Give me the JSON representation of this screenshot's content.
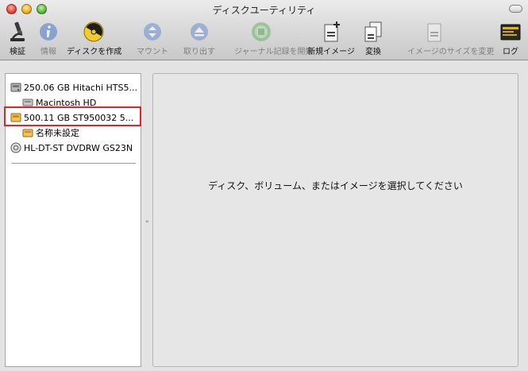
{
  "window": {
    "title": "ディスクユーティリティ"
  },
  "toolbar": {
    "items": [
      {
        "label": "検証",
        "icon": "microscope-icon",
        "enabled": true
      },
      {
        "label": "情報",
        "icon": "info-icon",
        "enabled": false
      },
      {
        "label": "ディスクを作成",
        "icon": "burn-icon",
        "enabled": true
      },
      {
        "label": "マウント",
        "icon": "mount-icon",
        "enabled": false
      },
      {
        "label": "取り出す",
        "icon": "eject-icon",
        "enabled": false
      },
      {
        "label": "ジャーナル記録を開始",
        "icon": "journal-icon",
        "enabled": false
      },
      {
        "label": "新規イメージ",
        "icon": "new-image-icon",
        "enabled": true
      },
      {
        "label": "変換",
        "icon": "convert-icon",
        "enabled": true
      },
      {
        "label": "イメージのサイズを変更",
        "icon": "resize-image-icon",
        "enabled": false
      },
      {
        "label": "ログ",
        "icon": "log-icon",
        "enabled": true
      }
    ]
  },
  "sidebar": {
    "items": [
      {
        "label": "250.06 GB Hitachi HTS5...",
        "icon": "hard-disk-icon",
        "level": 0
      },
      {
        "label": "Macintosh HD",
        "icon": "volume-icon",
        "level": 1
      },
      {
        "label": "500.11 GB ST950032 5...",
        "icon": "external-disk-icon",
        "level": 0,
        "selected": true
      },
      {
        "label": "名称未設定",
        "icon": "external-volume-icon",
        "level": 1
      },
      {
        "label": "HL-DT-ST DVDRW GS23N",
        "icon": "optical-drive-icon",
        "level": 0
      }
    ]
  },
  "main": {
    "prompt": "ディスク、ボリューム、またはイメージを選択してください"
  },
  "colors": {
    "selection_outline": "#e0262b",
    "content_bg": "#e6e6e6"
  }
}
